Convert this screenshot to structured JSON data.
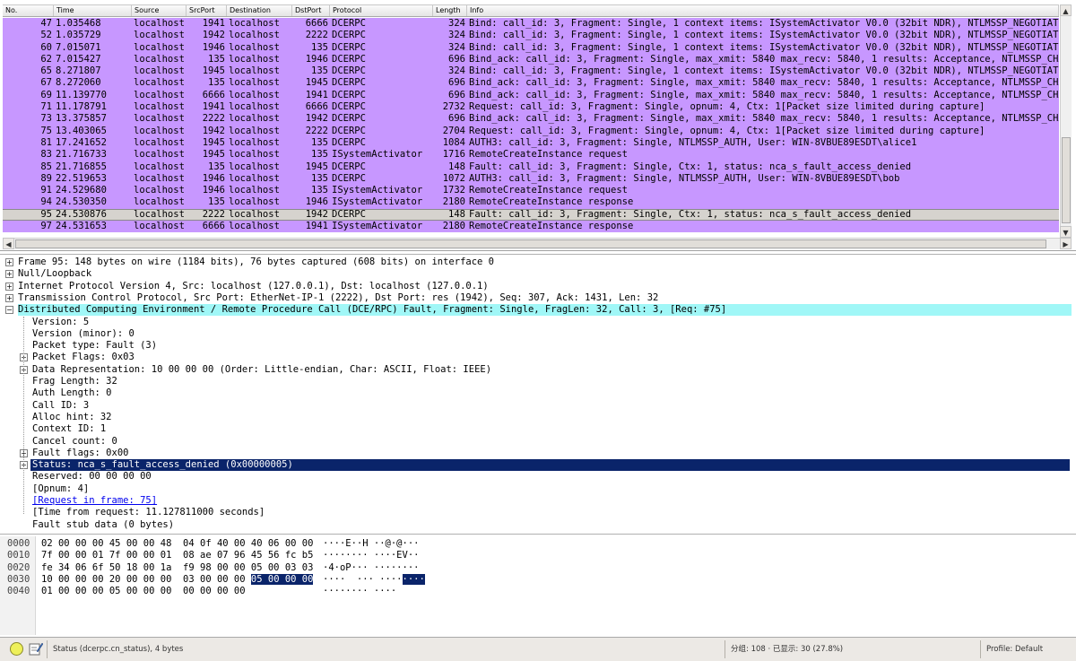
{
  "packet_list": {
    "columns": [
      "No.",
      "Time",
      "Source",
      "SrcPort",
      "Destination",
      "DstPort",
      "Protocol",
      "Length",
      "Info"
    ],
    "rows": [
      {
        "no": "47",
        "time": "1.035468",
        "src": "localhost",
        "sport": "1941",
        "dst": "localhost",
        "dport": "6666",
        "proto": "DCERPC",
        "len": "324",
        "info": "Bind: call_id: 3, Fragment: Single, 1 context items: ISystemActivator V0.0 (32bit NDR), NTLMSSP_NEGOTIATE"
      },
      {
        "no": "52",
        "time": "1.035729",
        "src": "localhost",
        "sport": "1942",
        "dst": "localhost",
        "dport": "2222",
        "proto": "DCERPC",
        "len": "324",
        "info": "Bind: call_id: 3, Fragment: Single, 1 context items: ISystemActivator V0.0 (32bit NDR), NTLMSSP_NEGOTIATE"
      },
      {
        "no": "60",
        "time": "7.015071",
        "src": "localhost",
        "sport": "1946",
        "dst": "localhost",
        "dport": "135",
        "proto": "DCERPC",
        "len": "324",
        "info": "Bind: call_id: 3, Fragment: Single, 1 context items: ISystemActivator V0.0 (32bit NDR), NTLMSSP_NEGOTIATE"
      },
      {
        "no": "62",
        "time": "7.015427",
        "src": "localhost",
        "sport": "135",
        "dst": "localhost",
        "dport": "1946",
        "proto": "DCERPC",
        "len": "696",
        "info": "Bind_ack: call_id: 3, Fragment: Single, max_xmit: 5840 max_recv: 5840, 1 results: Acceptance, NTLMSSP_CHAL"
      },
      {
        "no": "65",
        "time": "8.271807",
        "src": "localhost",
        "sport": "1945",
        "dst": "localhost",
        "dport": "135",
        "proto": "DCERPC",
        "len": "324",
        "info": "Bind: call_id: 3, Fragment: Single, 1 context items: ISystemActivator V0.0 (32bit NDR), NTLMSSP_NEGOTIATE"
      },
      {
        "no": "67",
        "time": "8.272060",
        "src": "localhost",
        "sport": "135",
        "dst": "localhost",
        "dport": "1945",
        "proto": "DCERPC",
        "len": "696",
        "info": "Bind_ack: call_id: 3, Fragment: Single, max_xmit: 5840 max_recv: 5840, 1 results: Acceptance, NTLMSSP_CHAL"
      },
      {
        "no": "69",
        "time": "11.139770",
        "src": "localhost",
        "sport": "6666",
        "dst": "localhost",
        "dport": "1941",
        "proto": "DCERPC",
        "len": "696",
        "info": "Bind_ack: call_id: 3, Fragment: Single, max_xmit: 5840 max_recv: 5840, 1 results: Acceptance, NTLMSSP_CHAL"
      },
      {
        "no": "71",
        "time": "11.178791",
        "src": "localhost",
        "sport": "1941",
        "dst": "localhost",
        "dport": "6666",
        "proto": "DCERPC",
        "len": "2732",
        "info": "Request: call_id: 3, Fragment: Single, opnum: 4, Ctx: 1[Packet size limited during capture]"
      },
      {
        "no": "73",
        "time": "13.375857",
        "src": "localhost",
        "sport": "2222",
        "dst": "localhost",
        "dport": "1942",
        "proto": "DCERPC",
        "len": "696",
        "info": "Bind_ack: call_id: 3, Fragment: Single, max_xmit: 5840 max_recv: 5840, 1 results: Acceptance, NTLMSSP_CHAL"
      },
      {
        "no": "75",
        "time": "13.403065",
        "src": "localhost",
        "sport": "1942",
        "dst": "localhost",
        "dport": "2222",
        "proto": "DCERPC",
        "len": "2704",
        "info": "Request: call_id: 3, Fragment: Single, opnum: 4, Ctx: 1[Packet size limited during capture]"
      },
      {
        "no": "81",
        "time": "17.241652",
        "src": "localhost",
        "sport": "1945",
        "dst": "localhost",
        "dport": "135",
        "proto": "DCERPC",
        "len": "1084",
        "info": "AUTH3: call_id: 3, Fragment: Single, NTLMSSP_AUTH, User: WIN-8VBUE89ESDT\\alice1"
      },
      {
        "no": "83",
        "time": "21.716733",
        "src": "localhost",
        "sport": "1945",
        "dst": "localhost",
        "dport": "135",
        "proto": "ISystemActivator",
        "len": "1716",
        "info": "RemoteCreateInstance request"
      },
      {
        "no": "85",
        "time": "21.716855",
        "src": "localhost",
        "sport": "135",
        "dst": "localhost",
        "dport": "1945",
        "proto": "DCERPC",
        "len": "148",
        "info": "Fault: call_id: 3, Fragment: Single, Ctx: 1, status: nca_s_fault_access_denied"
      },
      {
        "no": "89",
        "time": "22.519653",
        "src": "localhost",
        "sport": "1946",
        "dst": "localhost",
        "dport": "135",
        "proto": "DCERPC",
        "len": "1072",
        "info": "AUTH3: call_id: 3, Fragment: Single, NTLMSSP_AUTH, User: WIN-8VBUE89ESDT\\bob"
      },
      {
        "no": "91",
        "time": "24.529680",
        "src": "localhost",
        "sport": "1946",
        "dst": "localhost",
        "dport": "135",
        "proto": "ISystemActivator",
        "len": "1732",
        "info": "RemoteCreateInstance request"
      },
      {
        "no": "94",
        "time": "24.530350",
        "src": "localhost",
        "sport": "135",
        "dst": "localhost",
        "dport": "1946",
        "proto": "ISystemActivator",
        "len": "2180",
        "info": "RemoteCreateInstance response"
      },
      {
        "no": "95",
        "time": "24.530876",
        "src": "localhost",
        "sport": "2222",
        "dst": "localhost",
        "dport": "1942",
        "proto": "DCERPC",
        "len": "148",
        "info": "Fault: call_id: 3, Fragment: Single, Ctx: 1, status: nca_s_fault_access_denied",
        "selected": true
      },
      {
        "no": "97",
        "time": "24.531653",
        "src": "localhost",
        "sport": "6666",
        "dst": "localhost",
        "dport": "1941",
        "proto": "ISystemActivator",
        "len": "2180",
        "info": "RemoteCreateInstance response"
      }
    ],
    "row_color": "#c797ff",
    "selected_row_color": "#d6d3ce"
  },
  "details": {
    "lines": [
      {
        "text": "Frame 95: 148 bytes on wire (1184 bits), 76 bytes captured (608 bits) on interface 0",
        "level": 0,
        "expander": true
      },
      {
        "text": "Null/Loopback",
        "level": 0,
        "expander": true
      },
      {
        "text": "Internet Protocol Version 4, Src: localhost (127.0.0.1), Dst: localhost (127.0.0.1)",
        "level": 0,
        "expander": true
      },
      {
        "text": "Transmission Control Protocol, Src Port: EtherNet-IP-1 (2222), Dst Port: res (1942), Seq: 307, Ack: 1431, Len: 32",
        "level": 0,
        "expander": true
      },
      {
        "text": "Distributed Computing Environment / Remote Procedure Call (DCE/RPC) Fault, Fragment: Single, FragLen: 32, Call: 3, [Req: #75]",
        "level": 0,
        "expander": true,
        "expanded": true,
        "highlight": "cyan"
      },
      {
        "text": "Version: 5",
        "level": 1
      },
      {
        "text": "Version (minor): 0",
        "level": 1
      },
      {
        "text": "Packet type: Fault (3)",
        "level": 1
      },
      {
        "text": "Packet Flags: 0x03",
        "level": 1,
        "expander": true
      },
      {
        "text": "Data Representation: 10 00 00 00 (Order: Little-endian, Char: ASCII, Float: IEEE)",
        "level": 1,
        "expander": true
      },
      {
        "text": "Frag Length: 32",
        "level": 1
      },
      {
        "text": "Auth Length: 0",
        "level": 1
      },
      {
        "text": "Call ID: 3",
        "level": 1
      },
      {
        "text": "Alloc hint: 32",
        "level": 1
      },
      {
        "text": "Context ID: 1",
        "level": 1
      },
      {
        "text": "Cancel count: 0",
        "level": 1
      },
      {
        "text": "Fault flags: 0x00",
        "level": 1,
        "expander": true
      },
      {
        "text": "Status: nca_s_fault_access_denied (0x00000005)",
        "level": 1,
        "expander": true,
        "highlight": "selected"
      },
      {
        "text": "Reserved: 00 00 00 00",
        "level": 1
      },
      {
        "text": "[Opnum: 4]",
        "level": 1
      },
      {
        "text": "[Request in frame: 75]",
        "level": 1,
        "link": true
      },
      {
        "text": "[Time from request: 11.127811000 seconds]",
        "level": 1
      },
      {
        "text": "Fault stub data (0 bytes)",
        "level": 1
      }
    ],
    "highlight_color": "#a0f7f7",
    "selected_color": "#0a246a"
  },
  "hex": {
    "rows": [
      {
        "offset": "0000",
        "bytes": "02 00 00 00 45 00 00 48  04 0f 40 00 40 06 00 00",
        "ascii": "····E··H ··@·@···"
      },
      {
        "offset": "0010",
        "bytes": "7f 00 00 01 7f 00 00 01  08 ae 07 96 45 56 fc b5",
        "ascii": "········ ····EV··"
      },
      {
        "offset": "0020",
        "bytes": "fe 34 06 6f 50 18 00 1a  f9 98 00 00 05 00 03 03",
        "ascii": "·4·oP··· ········"
      },
      {
        "offset": "0030",
        "bytes": "10 00 00 00 20 00 00 00  03 00 00 00 ",
        "bytes_sel": "05 00 00 00",
        "ascii": "····  ··· ····",
        "ascii_sel": "····"
      },
      {
        "offset": "0040",
        "bytes": "01 00 00 00 05 00 00 00  00 00 00 00",
        "ascii": "········ ····"
      }
    ]
  },
  "status_bar": {
    "field_info": "Status (dcerpc.cn_status), 4 bytes",
    "counts": "分组: 108 · 已显示: 30 (27.8%)",
    "profile": "Profile: Default"
  }
}
